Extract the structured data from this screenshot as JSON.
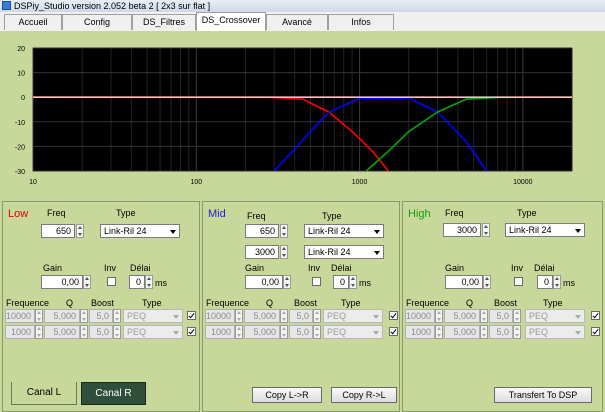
{
  "window": {
    "title": "DSPiy_Studio version 2.052 beta 2 [ 2x3 sur flat ]"
  },
  "tabs": [
    {
      "label": "Accueil",
      "active": false
    },
    {
      "label": "Config",
      "active": false
    },
    {
      "label": "DS_Filtres",
      "active": false
    },
    {
      "label": "DS_Crossover",
      "active": true
    },
    {
      "label": "Avancé",
      "active": false
    },
    {
      "label": "Infos",
      "active": false
    }
  ],
  "colors": {
    "background": "#c8d89a",
    "plot_bg": "#000000",
    "low": "#ff0000",
    "mid": "#0000ff",
    "high": "#00aa00",
    "flat": "#ffc0c0"
  },
  "chart_data": {
    "type": "line",
    "xscale": "log",
    "xlim": [
      10,
      20000
    ],
    "ylim": [
      -30,
      20
    ],
    "x_ticks": [
      "10",
      "100",
      "1000",
      "10000"
    ],
    "y_ticks": [
      "20",
      "10",
      "0",
      "-10",
      "-20",
      "-30"
    ],
    "grid": true,
    "series": [
      {
        "color": "#ff0000",
        "x": [
          10,
          300,
          450,
          650,
          900,
          1200,
          1500
        ],
        "y": [
          0,
          -0.1,
          -0.8,
          -6,
          -14,
          -22,
          -30
        ]
      },
      {
        "color": "#0000ff",
        "x": [
          300,
          400,
          500,
          650,
          1000,
          2000,
          3000,
          4500,
          6000
        ],
        "y": [
          -30,
          -21,
          -14,
          -6,
          -0.5,
          -0.3,
          -6,
          -18,
          -30
        ]
      },
      {
        "color": "#00aa00",
        "x": [
          1100,
          1500,
          2000,
          3000,
          4500,
          7000,
          20000
        ],
        "y": [
          -30,
          -22,
          -14,
          -6,
          -0.8,
          -0.1,
          0
        ]
      },
      {
        "color": "#ffc0c0",
        "x": [
          10,
          20000
        ],
        "y": [
          0,
          0
        ]
      }
    ]
  },
  "labels": {
    "freq": "Freq",
    "type": "Type",
    "gain": "Gain",
    "inv": "Inv",
    "delai": "Délai",
    "ms": "ms",
    "frequence": "Frequence",
    "q": "Q",
    "boost": "Boost"
  },
  "panels": {
    "low": {
      "title": "Low",
      "title_color": "#e00000",
      "freq1": "650",
      "type1": "Link-Ril 24",
      "gain": "0,00",
      "delai": "0",
      "peq": [
        {
          "freq": "10000",
          "q": "5,000",
          "boost": "5,0",
          "type": "PEQ",
          "checked": true
        },
        {
          "freq": "1000",
          "q": "5,000",
          "boost": "5,0",
          "type": "PEQ",
          "checked": true
        }
      ]
    },
    "mid": {
      "title": "Mid",
      "title_color": "#2020d0",
      "freq1": "650",
      "type1": "Link-Ril 24",
      "freq2": "3000",
      "type2": "Link-Ril 24",
      "gain": "0,00",
      "delai": "0",
      "peq": [
        {
          "freq": "10000",
          "q": "5,000",
          "boost": "5,0",
          "type": "PEQ",
          "checked": true
        },
        {
          "freq": "1000",
          "q": "5,000",
          "boost": "5,0",
          "type": "PEQ",
          "checked": true
        }
      ]
    },
    "high": {
      "title": "High",
      "title_color": "#10a010",
      "freq1": "3000",
      "type1": "Link-Ril 24",
      "gain": "0,00",
      "delai": "0",
      "peq": [
        {
          "freq": "10000",
          "q": "5,000",
          "boost": "5,0",
          "type": "PEQ",
          "checked": true
        },
        {
          "freq": "1000",
          "q": "5,000",
          "boost": "5,0",
          "type": "PEQ",
          "checked": true
        }
      ]
    }
  },
  "bottom": {
    "canal_l": "Canal L",
    "canal_r": "Canal R",
    "copy_lr": "Copy L->R",
    "copy_rl": "Copy R->L",
    "transfert": "Transfert To DSP"
  }
}
